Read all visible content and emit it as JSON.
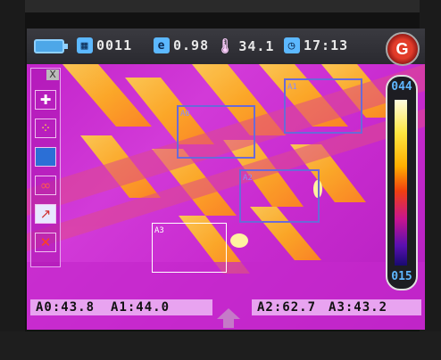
{
  "status": {
    "folder_count": "0011",
    "emissivity": "0.98",
    "temperature": "34.1",
    "time": "17:13",
    "logo_letter": "G",
    "icons": [
      "battery-icon",
      "folder-icon",
      "emissivity-icon",
      "thermometer-icon",
      "clock-icon"
    ]
  },
  "toolbar": {
    "close_label": "X",
    "tools": [
      "cursor-cross-icon",
      "multi-point-icon",
      "area-box-icon",
      "line-tool-icon",
      "chart-icon",
      "delete-icon"
    ]
  },
  "scale": {
    "max": "044",
    "min": "015"
  },
  "rois": [
    {
      "tag": "A0"
    },
    {
      "tag": "A1"
    },
    {
      "tag": "A2"
    },
    {
      "tag": "A3"
    }
  ],
  "readouts": {
    "a0": "A0:43.8",
    "a1": "A1:44.0",
    "a2": "A2:62.7",
    "a3": "A3:43.2"
  }
}
